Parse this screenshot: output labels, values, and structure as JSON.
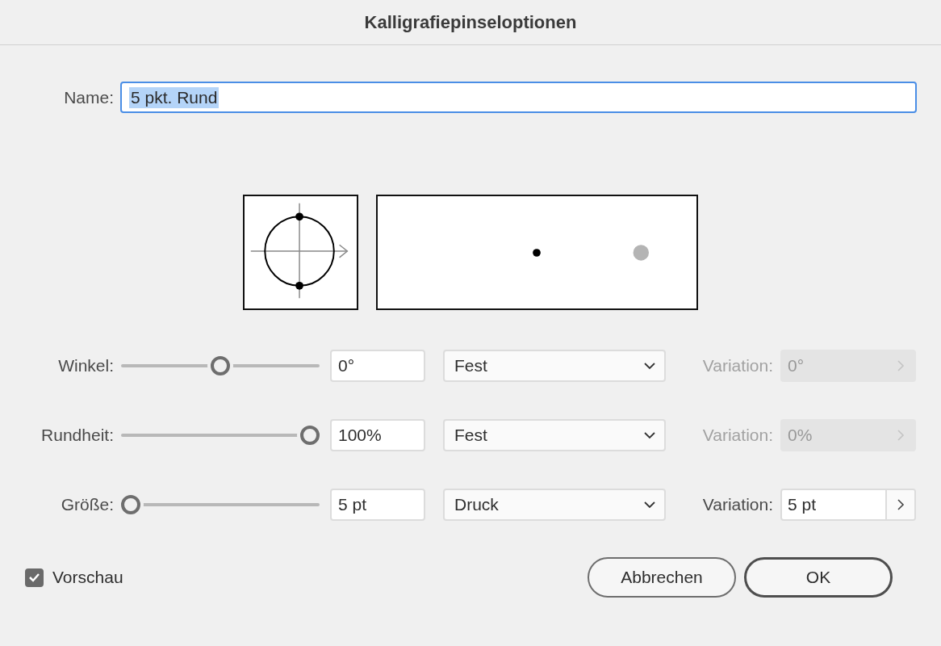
{
  "window": {
    "title": "Kalligrafiepinseloptionen"
  },
  "name_field": {
    "label": "Name:",
    "value": "5 pkt. Rund",
    "text_selected": true
  },
  "parameters": [
    {
      "label": "Winkel:",
      "level": 0.5,
      "value": "0°",
      "mode": "Fest",
      "variation_label": "Variation:",
      "variation": "0°",
      "variation_disabled": true
    },
    {
      "label": "Rundheit:",
      "level": 1,
      "value": "100%",
      "mode": "Fest",
      "variation_label": "Variation:",
      "variation": "0%",
      "variation_disabled": true
    },
    {
      "label": "Größe:",
      "level": 0,
      "value": "5 pt",
      "mode": "Druck",
      "variation_label": "Variation:",
      "variation": "5 pt",
      "variation_disabled": false
    }
  ],
  "preview": {
    "label": "Vorschau",
    "checked": true
  },
  "buttons": [
    {
      "label": "Abbrechen",
      "default": false
    },
    {
      "label": "OK",
      "default": true
    }
  ]
}
